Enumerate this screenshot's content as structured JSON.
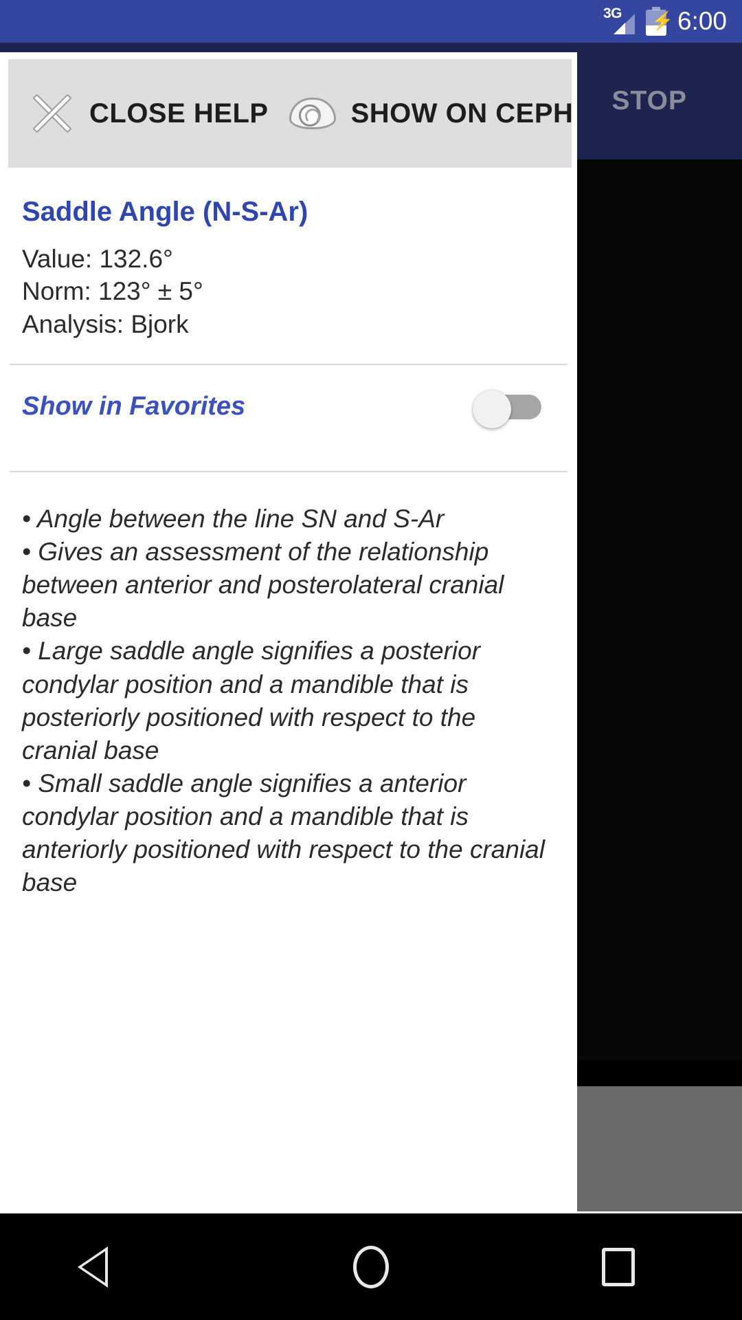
{
  "status_bar": {
    "network_label": "3G",
    "network_icon": "signal-triangle-icon",
    "battery_icon": "battery-charging-icon",
    "clock": "6:00"
  },
  "background_app": {
    "stop_label": "STOP",
    "xray_label": "cephalometric-xray"
  },
  "help_panel": {
    "toolbar": {
      "close_icon": "close-x-icon",
      "close_label": "CLOSE HELP",
      "eye_icon": "eye-icon",
      "show_label": "SHOW ON CEPH"
    },
    "metric": {
      "title": "Saddle Angle (N-S-Ar)",
      "value_line": "Value: 132.6°",
      "norm_line": "Norm: 123° ± 5°",
      "analysis_line": "Analysis: Bjork"
    },
    "favorites": {
      "label": "Show in Favorites",
      "toggle_state": "off"
    },
    "description": {
      "lines": [
        "• Angle between the line SN and S-Ar",
        "• Gives an assessment of the relationship between anterior and posterolateral cranial base",
        "• Large saddle angle signifies a posterior condylar position and a mandible that is posteriorly positioned with respect to the cranial base",
        "• Small  saddle angle signifies a anterior condylar position and a mandible that is anteriorly positioned with respect to the cranial base"
      ]
    }
  },
  "nav_bar": {
    "back": "back-triangle-icon",
    "home": "home-circle-icon",
    "recents": "recents-square-icon"
  },
  "colors": {
    "status_bar_bg": "#3546a0",
    "app_bg": "#1d2450",
    "toolbar_bg": "#dededf",
    "accent_blue": "#2f47ad",
    "favorites_blue": "#3a51be",
    "text_dark": "#2b2b2b",
    "toggle_track": "#a6a6a6",
    "toggle_thumb": "#f1f1f1",
    "nav_bg": "#000000",
    "stop_text": "#8a8d99"
  }
}
